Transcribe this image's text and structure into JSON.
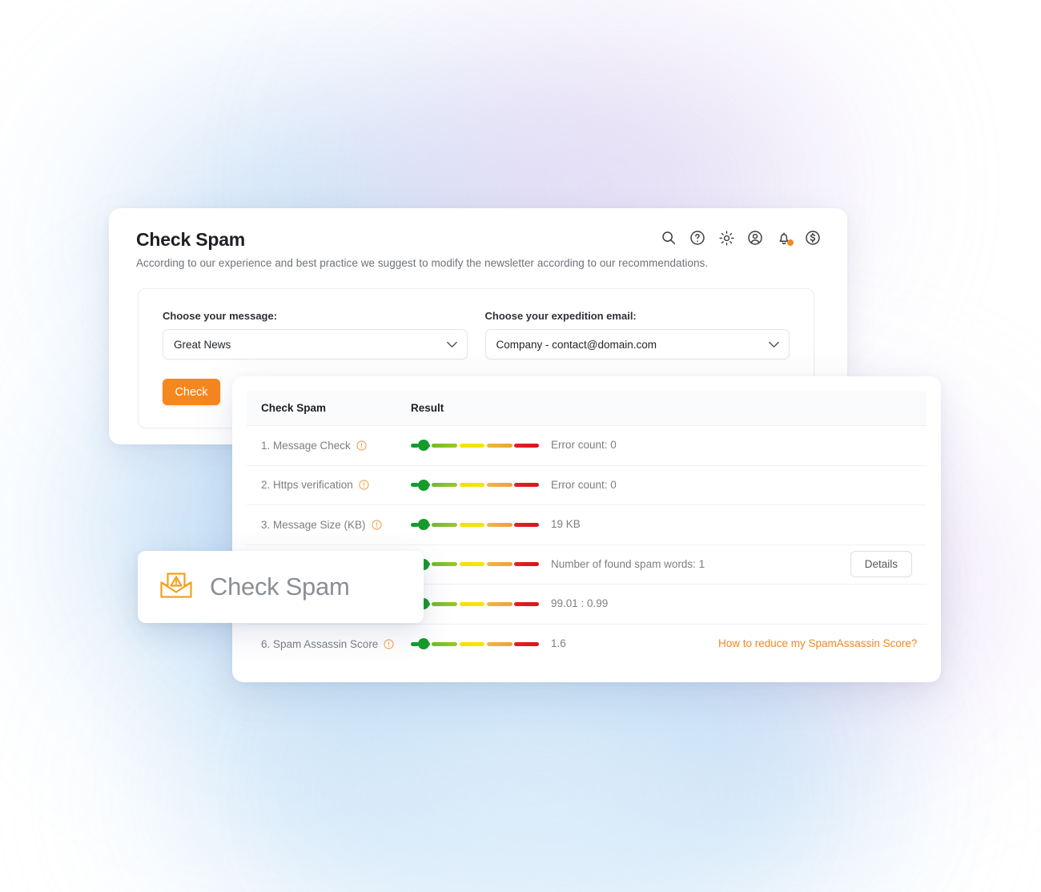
{
  "header": {
    "title": "Check Spam",
    "subtitle": "According to our experience and best practice we suggest to modify the newsletter according to our recommendations.",
    "icons": [
      {
        "name": "search-icon",
        "label": "Search"
      },
      {
        "name": "help-icon",
        "label": "Help"
      },
      {
        "name": "gear-icon",
        "label": "Settings"
      },
      {
        "name": "user-icon",
        "label": "Account"
      },
      {
        "name": "bell-icon",
        "label": "Notifications",
        "badge": true
      },
      {
        "name": "dollar-icon",
        "label": "Billing"
      }
    ]
  },
  "form": {
    "message_label": "Choose your message:",
    "message_value": "Great News",
    "email_label": "Choose your expedition email:",
    "email_value": "Company - contact@domain.com",
    "check_button": "Check"
  },
  "results": {
    "columns": {
      "name": "Check Spam",
      "result": "Result"
    },
    "rows": [
      {
        "label": "1. Message Check",
        "value": "Error count:  0",
        "action": "",
        "gauge_position": 1
      },
      {
        "label": "2. Https verification",
        "value": "Error count:  0",
        "action": "",
        "gauge_position": 1
      },
      {
        "label": "3. Message Size (KB)",
        "value": "19  KB",
        "action": "",
        "gauge_position": 1
      },
      {
        "label": "",
        "value": "Number of found spam words:  1",
        "action": "Details",
        "action_type": "button",
        "gauge_position": 1
      },
      {
        "label": "",
        "value": "99.01 : 0.99",
        "action": "",
        "gauge_position": 1
      },
      {
        "label": "6. Spam Assassin Score",
        "value": "1.6",
        "action": "How to reduce my SpamAssassin Score?",
        "action_type": "link",
        "gauge_position": 1
      }
    ]
  },
  "floating_card": {
    "label": "Check Spam",
    "icon": "envelope-warning-icon"
  },
  "colors": {
    "accent": "#f5871f",
    "title": "#1c2025",
    "muted": "#7a7f85",
    "gauge_green": "#169a2b",
    "gauge_yellow": "#f2e209",
    "gauge_orange": "#eda23c",
    "gauge_red": "#e21f26"
  }
}
